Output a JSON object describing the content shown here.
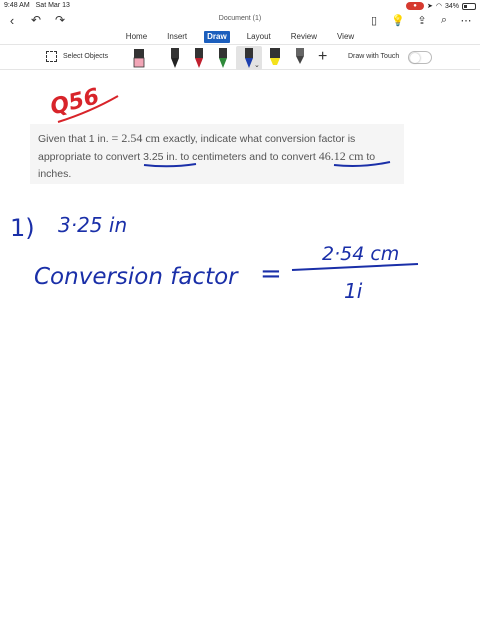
{
  "status_bar": {
    "time": "9:48 AM",
    "date": "Sat Mar 13",
    "battery": "34%"
  },
  "window": {
    "title": "Document (1)"
  },
  "ribbon": {
    "tabs": [
      {
        "label": "Home"
      },
      {
        "label": "Insert"
      },
      {
        "label": "Draw"
      },
      {
        "label": "Layout"
      },
      {
        "label": "Review"
      },
      {
        "label": "View"
      }
    ],
    "active_tab": "Draw"
  },
  "toolbar": {
    "select_objects_label": "Select Objects",
    "draw_with_touch_label": "Draw with Touch",
    "draw_with_touch_on": false,
    "pens": [
      {
        "name": "eraser",
        "color": "#f2a6b7"
      },
      {
        "name": "pen-black",
        "color": "#222222"
      },
      {
        "name": "pen-red",
        "color": "#c0202e"
      },
      {
        "name": "pen-green",
        "color": "#2f8a3a"
      },
      {
        "name": "pen-blue",
        "color": "#1d3fae",
        "selected": true
      },
      {
        "name": "highlighter-yellow",
        "color": "#f4e21c"
      },
      {
        "name": "pencil-gray",
        "color": "#555555"
      }
    ]
  },
  "document": {
    "question_segments": {
      "p1": "Given that 1 in. ",
      "p2": "= 2.54 cm",
      "p3": " exactly, indicate what conversion factor is appropriate to convert ",
      "p4": "3.25 in.",
      "p5": " to centimeters and to convert ",
      "p6": "46.12 cm",
      "p7": " to inches."
    },
    "handwriting": {
      "label": "Q56",
      "item_number": "1)",
      "given": "3·25 in",
      "conversion_label": "Conversion factor",
      "equals": "=",
      "numerator": "2·54 cm",
      "denominator": "1i"
    }
  },
  "colors": {
    "accent": "#1b5ebd",
    "ink_blue": "#1a2fa8",
    "ink_red": "#d8242a"
  }
}
